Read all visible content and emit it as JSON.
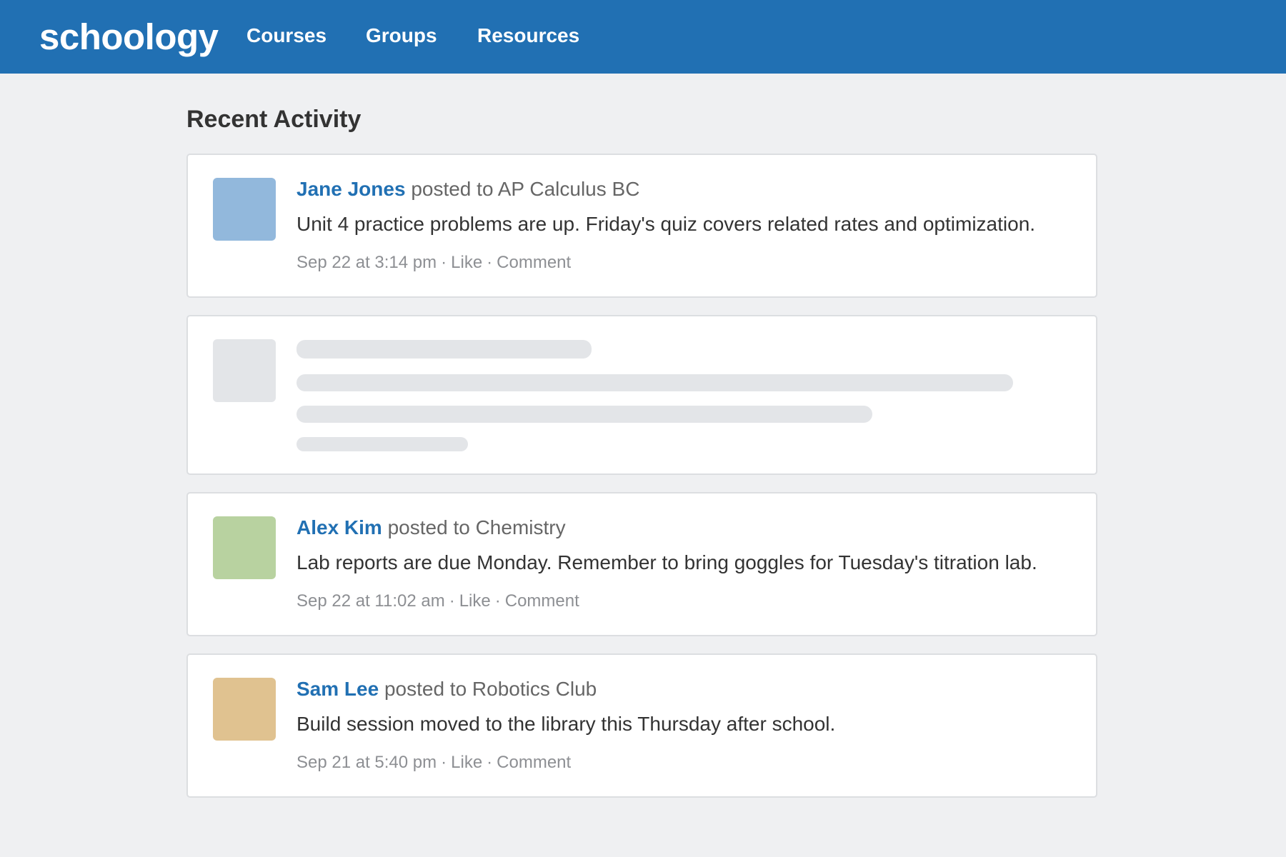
{
  "header": {
    "logo": "schoology",
    "nav": [
      "Courses",
      "Groups",
      "Resources"
    ]
  },
  "main": {
    "title": "Recent Activity",
    "posts": [
      {
        "author": "Jane Jones",
        "target": "posted to AP Calculus BC",
        "body": "Unit 4 practice problems are up. Friday's quiz covers related rates and optimization.",
        "time": "Sep 22 at 3:14 pm",
        "like": "Like",
        "comment": "Comment",
        "avatar_color": "#92b8dc"
      },
      {
        "author": "Alex Kim",
        "target": "posted to Chemistry",
        "body": "Lab reports are due Monday. Remember to bring goggles for Tuesday's titration lab.",
        "time": "Sep 22 at 11:02 am",
        "like": "Like",
        "comment": "Comment",
        "avatar_color": "#b8d2a0"
      },
      {
        "author": "Sam Lee",
        "target": "posted to Robotics Club",
        "body": "Build session moved to the library this Thursday after school.",
        "time": "Sep 21 at 5:40 pm",
        "like": "Like",
        "comment": "Comment",
        "avatar_color": "#e0c290"
      }
    ],
    "loading_placeholder": {
      "state": "loading",
      "color": "#e3e5e8"
    }
  },
  "colors": {
    "header_bg": "#2170b3",
    "page_bg": "#eff0f2",
    "link": "#2170b3",
    "meta_text": "#8d8f93"
  }
}
